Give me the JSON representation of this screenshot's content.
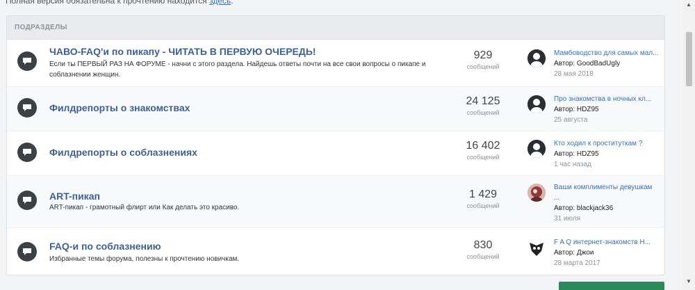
{
  "top_note": {
    "text": "Полная версия обязательна к прочтению находится ",
    "link": "здесь",
    "tail": "."
  },
  "section": {
    "header": "ПОДРАЗДЕЛЫ",
    "forums": [
      {
        "title": "ЧАВО-FAQ'и по пикапу - ЧИТАТЬ В ПЕРВУЮ ОЧЕРЕДЬ!",
        "description": "Если ты ПЕРВЫЙ РАЗ НА ФОРУМЕ - начни с этого раздела. Найдешь ответы почти на все свои вопросы о пикапе и соблазнении женщин.",
        "count": "929",
        "count_label": "сообщений",
        "last_title": "Мамбоводство для самых мал...",
        "last_author": "Автор: GoodBadUgly",
        "last_date": "28 мая 2018",
        "avatar": "default-avatar-icon"
      },
      {
        "title": "Филдрепорты о знакомствах",
        "description": "",
        "count": "24 125",
        "count_label": "сообщений",
        "last_title": "Про знакомства в ночных кл...",
        "last_author": "Автор: HDZ95",
        "last_date": "25 августа",
        "avatar": "default-avatar-icon"
      },
      {
        "title": "Филдрепорты о соблазнениях",
        "description": "",
        "count": "16 402",
        "count_label": "сообщений",
        "last_title": "Кто ходил к проституткам ?",
        "last_author": "Автор: HDZ95",
        "last_date": "1 час назад",
        "avatar": "default-avatar-icon"
      },
      {
        "title": "ART-пикап",
        "description": "ART-пикап - грамотный флирт или Как делать это красиво.",
        "count": "1 429",
        "count_label": "сообщений",
        "last_title": "Ваши комплименты девушкам",
        "last_title_2": "...",
        "last_author": "Автор: blackjack36",
        "last_date": "31 июля",
        "avatar": "photo-avatar-icon"
      },
      {
        "title": "FAQ-и по соблазнению",
        "description": "Избранные темы форума, полезны к прочтению новичкам.",
        "count": "830",
        "count_label": "сообщений",
        "last_title": "F A Q интернет-знакомств Н...",
        "last_author": "Автор: Джои",
        "last_date": "28 марта 2017",
        "avatar": "emblem-avatar-icon"
      }
    ]
  },
  "colors": {
    "link": "#3b6fb6",
    "title": "#3b5f96",
    "icon_bg": "#3c4146",
    "accent_button": "#2b8a5a"
  }
}
